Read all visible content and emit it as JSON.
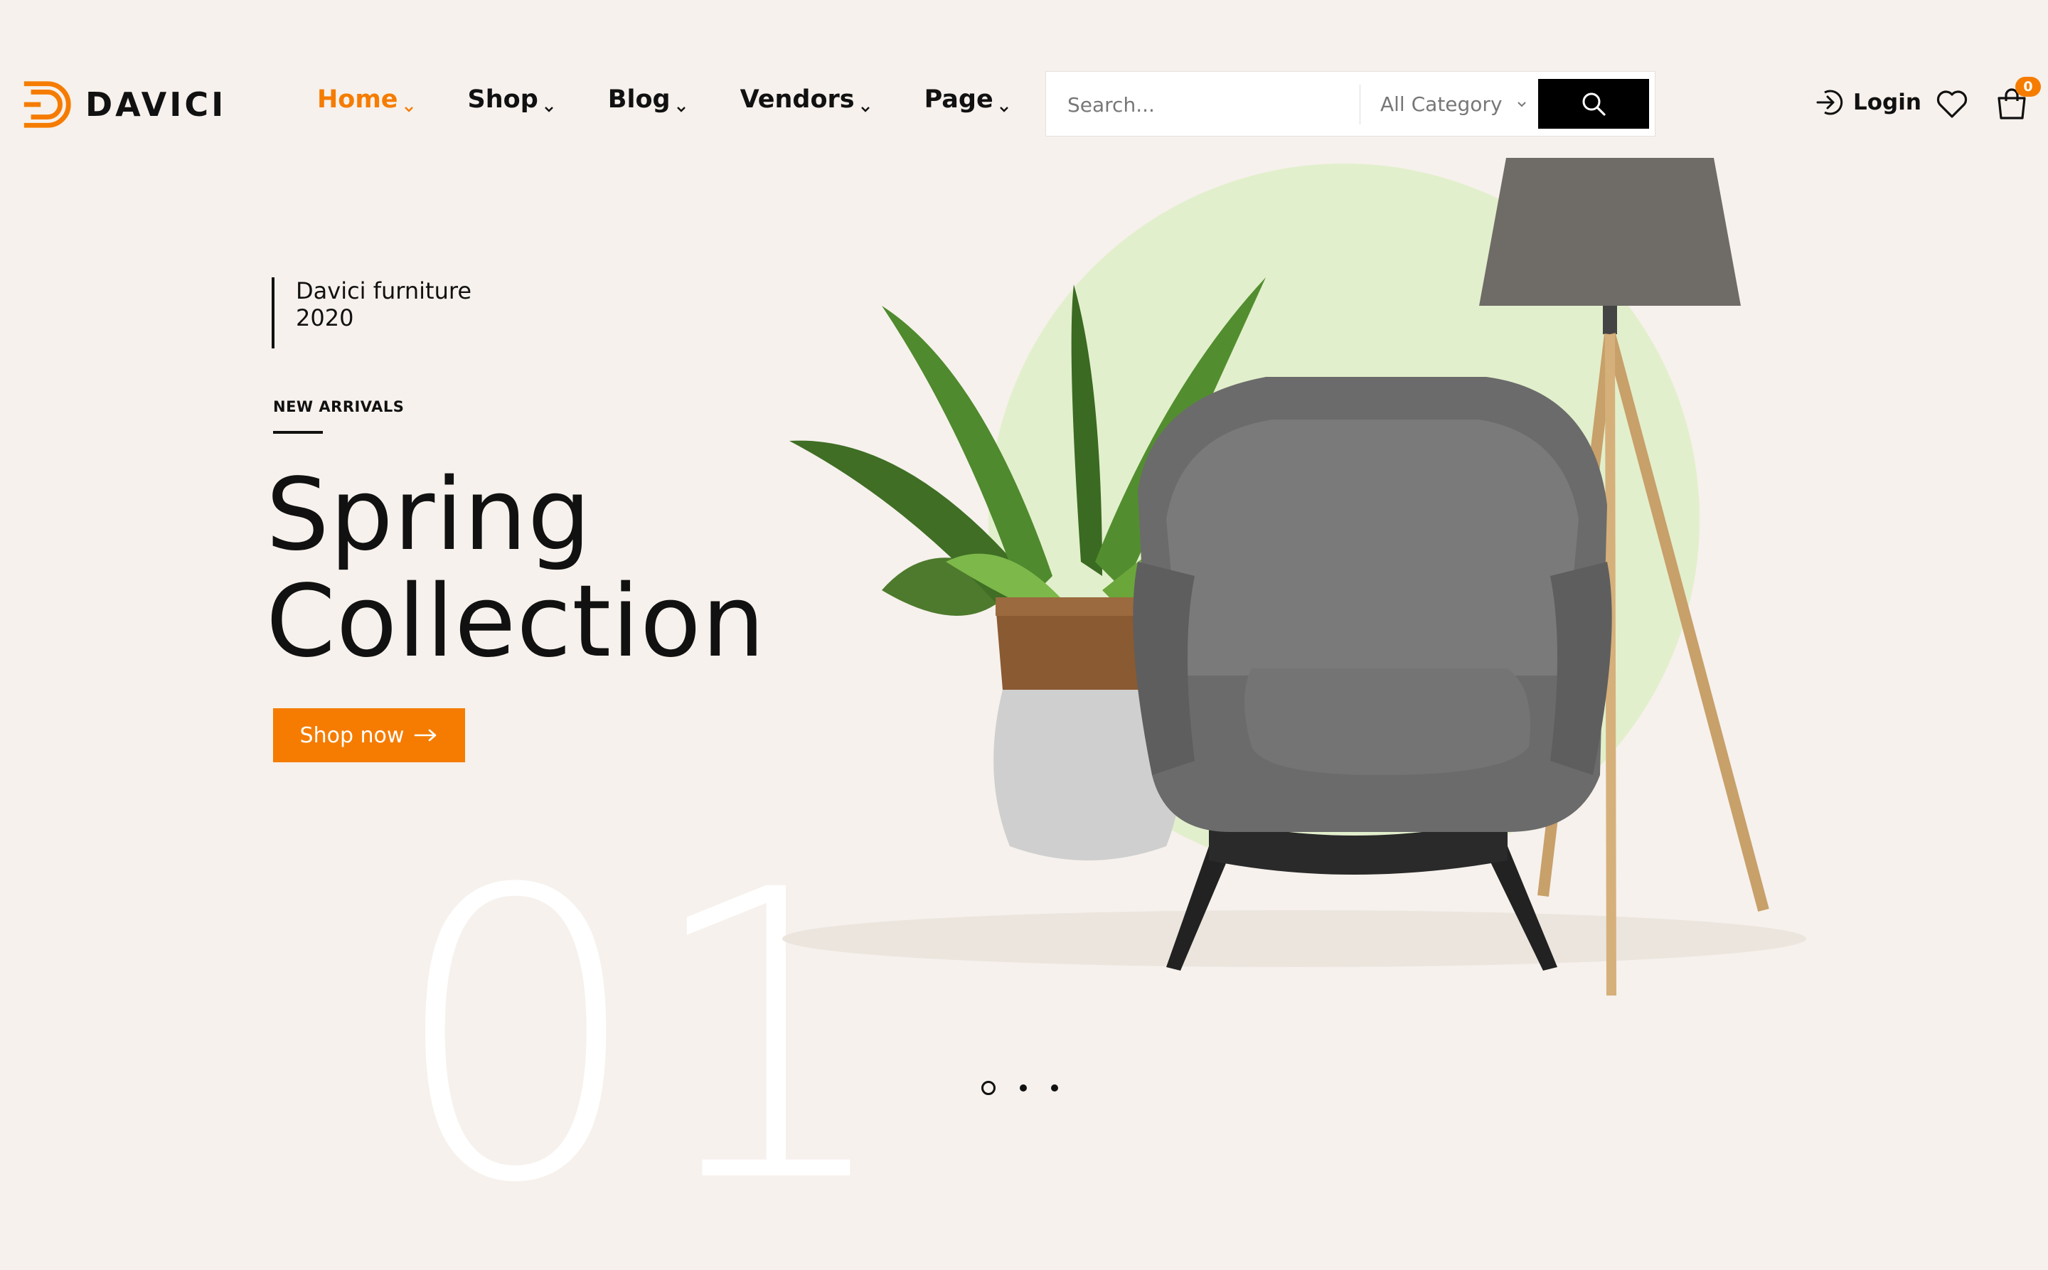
{
  "brand": {
    "name": "DAVICI",
    "accent": "#f57c00"
  },
  "nav": [
    {
      "label": "Home",
      "active": true
    },
    {
      "label": "Shop",
      "active": false
    },
    {
      "label": "Blog",
      "active": false
    },
    {
      "label": "Vendors",
      "active": false
    },
    {
      "label": "Page",
      "active": false
    }
  ],
  "search": {
    "placeholder": "Search...",
    "category": "All Category",
    "icon": "search-icon"
  },
  "account": {
    "login_label": "Login",
    "wishlist_icon": "heart-icon",
    "cart_icon": "shopping-bag-icon",
    "cart_count": "0"
  },
  "hero": {
    "kicker_line1": "Davici furniture",
    "kicker_line2": "2020",
    "tag": "NEW ARRIVALS",
    "title_line1": "Spring",
    "title_line2": "Collection",
    "cta_label": "Shop now",
    "slide_number": "01"
  },
  "slider": {
    "count": 3,
    "active": 1
  }
}
